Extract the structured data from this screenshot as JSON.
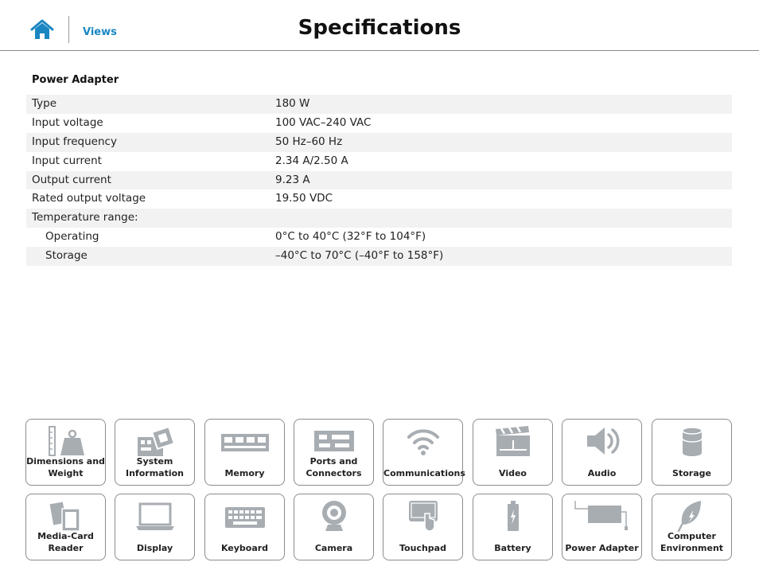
{
  "header": {
    "home_icon": "home-icon",
    "views_link": "Views",
    "title": "Specifications"
  },
  "section": {
    "title": "Power Adapter",
    "rows": [
      {
        "label": "Type",
        "value": "180 W"
      },
      {
        "label": "Input voltage",
        "value": "100 VAC–240 VAC"
      },
      {
        "label": "Input frequency",
        "value": "50 Hz–60 Hz"
      },
      {
        "label": "Input current",
        "value": "2.34 A/2.50 A"
      },
      {
        "label": "Output current",
        "value": "9.23 A"
      },
      {
        "label": "Rated output voltage",
        "value": "19.50 VDC"
      },
      {
        "label": "Temperature range:",
        "value": ""
      },
      {
        "label": "Operating",
        "value": "0°C to 40°C (32°F to 104°F)"
      },
      {
        "label": "Storage",
        "value": "–40°C to 70°C (–40°F to 158°F)"
      }
    ]
  },
  "nav": {
    "tiles": [
      {
        "label": "Dimensions and\nWeight",
        "icon": "weight-icon"
      },
      {
        "label": "System\nInformation",
        "icon": "motherboard-icon"
      },
      {
        "label": "Memory",
        "icon": "memory-module-icon"
      },
      {
        "label": "Ports and\nConnectors",
        "icon": "ports-icon"
      },
      {
        "label": "Communications",
        "icon": "wifi-icon"
      },
      {
        "label": "Video",
        "icon": "clapperboard-icon"
      },
      {
        "label": "Audio",
        "icon": "speaker-icon"
      },
      {
        "label": "Storage",
        "icon": "storage-cylinder-icon"
      },
      {
        "label": "Media-Card\nReader",
        "icon": "media-card-icon"
      },
      {
        "label": "Display",
        "icon": "laptop-display-icon"
      },
      {
        "label": "Keyboard",
        "icon": "keyboard-icon"
      },
      {
        "label": "Camera",
        "icon": "webcam-icon"
      },
      {
        "label": "Touchpad",
        "icon": "touchpad-icon"
      },
      {
        "label": "Battery",
        "icon": "battery-icon"
      },
      {
        "label": "Power Adapter",
        "icon": "power-adapter-icon"
      },
      {
        "label": "Computer\nEnvironment",
        "icon": "leaf-icon"
      }
    ]
  },
  "colors": {
    "accent": "#1a87c2",
    "icon_gray": "#a8adb2",
    "row_shade": "#f2f2f2",
    "tile_border": "#8c8c8c"
  }
}
